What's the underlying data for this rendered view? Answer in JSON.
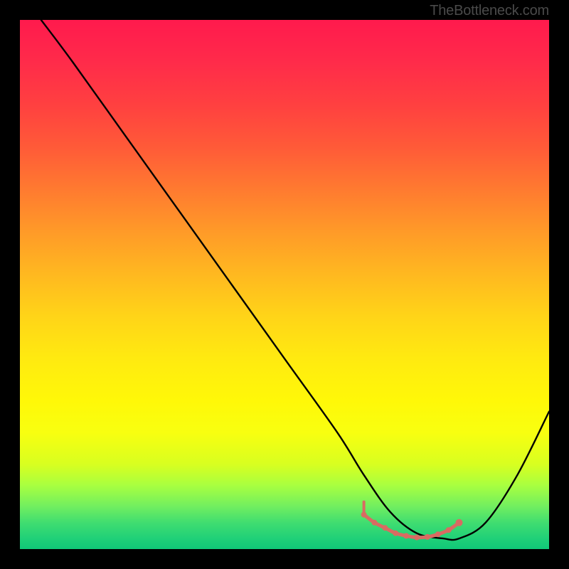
{
  "watermark": "TheBottleneck.com",
  "chart_data": {
    "type": "line",
    "title": "",
    "xlabel": "",
    "ylabel": "",
    "xlim": [
      0,
      100
    ],
    "ylim": [
      0,
      100
    ],
    "series": [
      {
        "name": "bottleneck-curve",
        "x": [
          4,
          10,
          20,
          30,
          40,
          50,
          60,
          65,
          70,
          75,
          80,
          83,
          88,
          94,
          100
        ],
        "y": [
          100,
          92,
          78,
          64,
          50,
          36,
          22,
          14,
          7,
          3,
          2,
          2,
          5,
          14,
          26
        ]
      }
    ],
    "highlight_segment": {
      "x": [
        65,
        67,
        69,
        71,
        73,
        75,
        77,
        79,
        81,
        83
      ],
      "y": [
        6.5,
        5,
        4,
        3,
        2.5,
        2.2,
        2.3,
        2.8,
        3.6,
        5
      ]
    },
    "gradient_colors": {
      "top": "#ff1a4d",
      "mid": "#ffe010",
      "bottom": "#10c878"
    }
  }
}
